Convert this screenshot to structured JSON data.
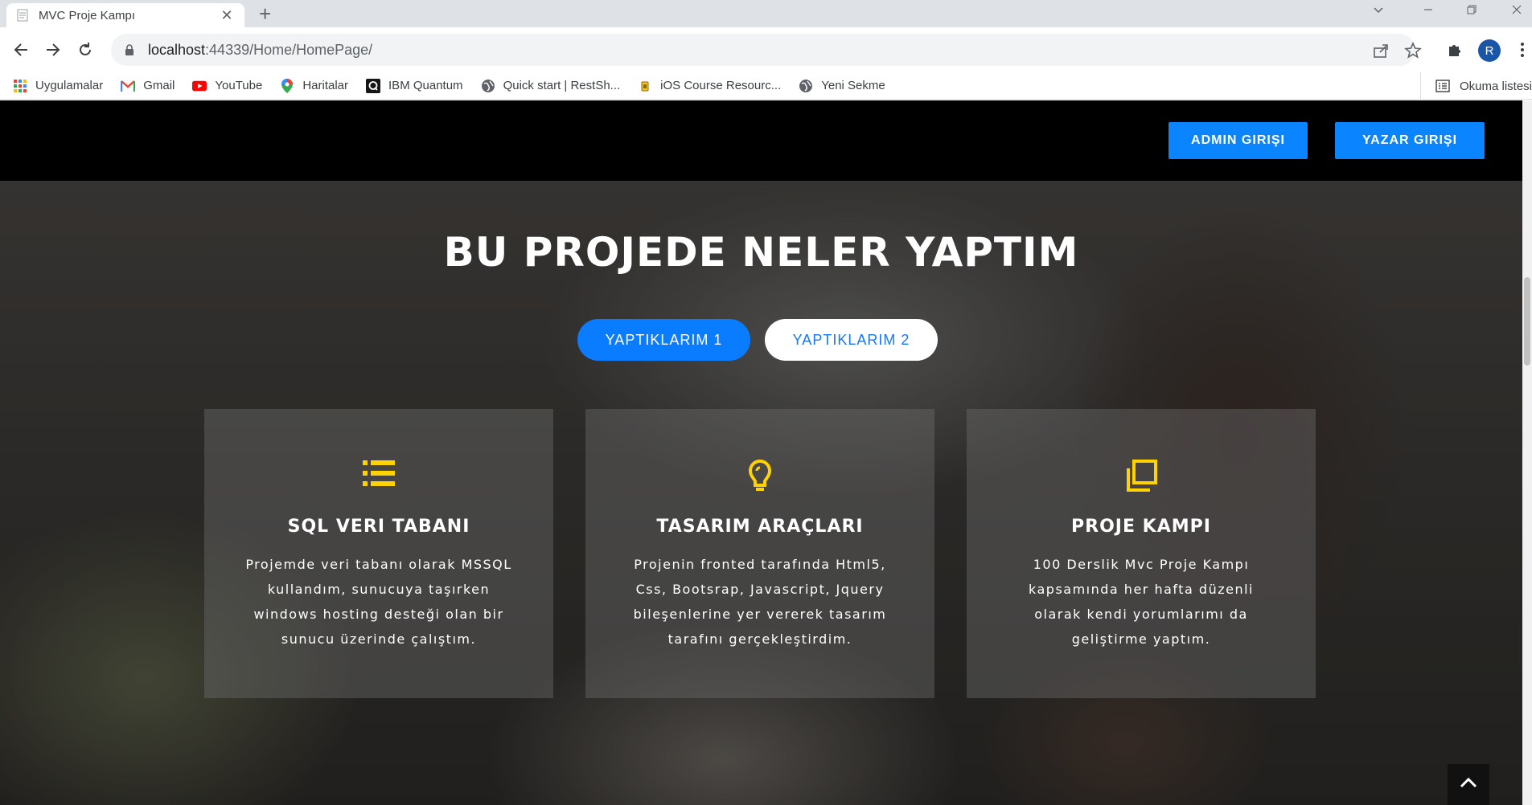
{
  "browser": {
    "tab": {
      "title": "MVC Proje Kampı",
      "close": "✕"
    },
    "new_tab": "+",
    "url_host": "localhost",
    "url_rest": ":44339/Home/HomePage/",
    "profile_initial": "R",
    "bookmarks": [
      {
        "label": "Uygulamalar",
        "icon": "apps-grid-icon"
      },
      {
        "label": "Gmail",
        "icon": "gmail-icon"
      },
      {
        "label": "YouTube",
        "icon": "youtube-icon"
      },
      {
        "label": "Haritalar",
        "icon": "maps-pin-icon"
      },
      {
        "label": "IBM Quantum",
        "icon": "ibm-quantum-icon"
      },
      {
        "label": "Quick start | RestSh...",
        "icon": "globe-icon"
      },
      {
        "label": "iOS Course Resourc...",
        "icon": "site-icon"
      },
      {
        "label": "Yeni Sekme",
        "icon": "globe-icon"
      }
    ],
    "reading_list": "Okuma listesi"
  },
  "page": {
    "header": {
      "admin_button": "ADMIN GIRIŞI",
      "author_button": "YAZAR GIRIŞI"
    },
    "section_title": "BU PROJEDE NELER YAPTIM",
    "tabs": [
      "YAPTIKLARIM 1",
      "YAPTIKLARIM 2"
    ],
    "active_tab_index": 0,
    "cards": [
      {
        "icon": "list-icon",
        "title": "SQL VERI TABANI",
        "text": "Projemde veri tabanı olarak MSSQL kullandım, sunucuya taşırken windows hosting desteği olan bir sunucu üzerinde çalıştım."
      },
      {
        "icon": "lightbulb-icon",
        "title": "TASARIM ARAÇLARI",
        "text": "Projenin fronted tarafında Html5, Css, Bootsrap, Javascript, Jquery bileşenlerine yer vererek tasarım tarafını gerçekleştirdim."
      },
      {
        "icon": "copy-icon",
        "title": "PROJE KAMPI",
        "text": "100 Derslik Mvc Proje Kampı kapsamında her hafta düzenli olarak kendi yorumlarımı da geliştirme yaptım."
      }
    ],
    "colors": {
      "accent": "#0a84ff",
      "icon_yellow": "#ffd200",
      "header_bg": "#000000"
    }
  }
}
